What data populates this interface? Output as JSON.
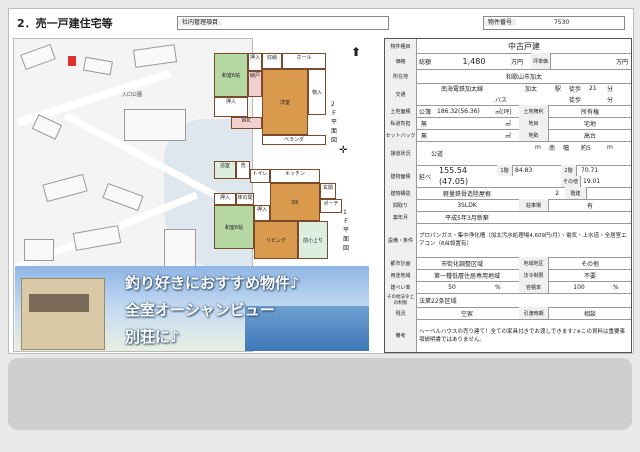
{
  "header": {
    "title": "2．売一戸建住宅等",
    "company_label": "社内管理項目",
    "number_label": "物件番号",
    "number_value": "7530"
  },
  "map": {
    "park_label": "入口公園"
  },
  "floorplan": {
    "second_floor": {
      "label": "2Ｆ平面図",
      "rooms": [
        "和室6帖",
        "押入",
        "洋室",
        "物入",
        "収納",
        "ホール",
        "納戸",
        "ベランダ",
        "押入",
        "WIC"
      ]
    },
    "first_floor": {
      "label": "1Ｆ平面図",
      "rooms": [
        "浴室",
        "洗",
        "トイレ",
        "キッチン",
        "DK",
        "和室6帖",
        "押入",
        "床の間",
        "リビング",
        "前小上り",
        "玄関",
        "ポーチ",
        "押入"
      ]
    }
  },
  "photo": {
    "catch_lines": [
      "釣り好きにおすすめ物件♪",
      "全室オーシャンビュー",
      "別荘に♪"
    ]
  },
  "spec": {
    "type_label": "物件種目",
    "type_value": "中古戸建",
    "price_label": "価格",
    "price_prefix": "総額",
    "price_value": "1,480",
    "price_unit": "万円",
    "tsubo_label": "坪単価",
    "tsubo_unit": "万円",
    "address_label": "所在地",
    "address_value": "和歌山市加太",
    "traffic_label": "交通",
    "line_value": "南海電鉄加太線",
    "station_value": "加太",
    "station_suffix": "駅",
    "walk1": "徒歩",
    "walk1_min": "21",
    "minute": "分",
    "bus_label": "バス",
    "walk2": "徒歩",
    "land_area_label": "土地面積",
    "land_area_prefix": "公簿",
    "land_area_value": "186.32(56.36)",
    "land_area_unit": "㎡(坪)",
    "land_right_label": "土地権利",
    "land_right_value": "所有権",
    "private_road_label": "私道負担",
    "private_road_value": "無",
    "unit_m2": "㎡",
    "land_category_label": "地目",
    "land_category_value": "宅地",
    "setback_label": "セットバック",
    "setback_value": "無",
    "terrain_label": "地勢",
    "terrain_value": "高台",
    "road_label": "接道状況",
    "road_type": "公道",
    "road_dir": "南",
    "road_width_label": "幅",
    "road_width_value": "約5",
    "unit_m": "m",
    "building_area_label": "建物面積",
    "building_area_prefix": "延べ",
    "building_area_value": "155.54",
    "building_area_tsubo": "(47.05)",
    "floor1_label": "1階",
    "floor1_value": "84.83",
    "floor2_label": "2階",
    "floor2_value": "70.71",
    "other_label": "その他",
    "other_value": "19.01",
    "structure_label": "建物構造",
    "structure_value": "軽量鉄骨造陸屋根",
    "floors_label": "階建",
    "floors_value": "2",
    "layout_label": "間取り",
    "layout_value": "3SLDK",
    "parking_label": "駐車場",
    "parking_value": "有",
    "built_label": "築年月",
    "built_value": "平成5年3月新築",
    "equipment_label": "設備・条件",
    "equipment_value": "プロパンガス・集中浄化槽（加太汚水処理場4,609円/月）・電気・上水道・全居室エアコン（6台設置有）",
    "city_plan_label": "都市計画",
    "city_plan_value": "市街化調整区域",
    "district_label": "地域地区",
    "district_value": "その他",
    "zoning_label": "用途地域",
    "zoning_value": "第一種低層住居専用地域",
    "restriction_label": "法令制限",
    "restriction_value": "不要",
    "coverage_label": "建ぺい率",
    "coverage_value": "50",
    "far_label": "容積率",
    "far_value": "100",
    "percent": "%",
    "legal_label": "その他法令上の制限",
    "legal_value": "法第22条区域",
    "status_label": "現況",
    "status_value": "空家",
    "handover_label": "引渡時期",
    "handover_value": "相談",
    "remarks_label": "備考",
    "remarks_value": "ヘーベルハウスの売り建て！全ての家具付きでお渡しできます♪※この資料は重要事項説明書ではありません。"
  }
}
